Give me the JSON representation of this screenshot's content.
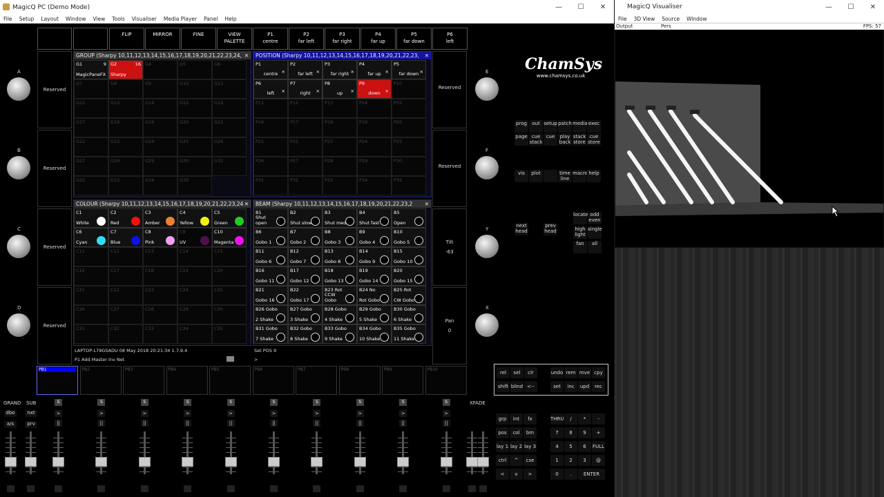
{
  "main_window": {
    "title": "MagicQ PC (Demo Mode)",
    "menu": [
      "File",
      "Setup",
      "Layout",
      "Window",
      "View",
      "Tools",
      "Visualiser",
      "Media Player",
      "Panel",
      "Help"
    ],
    "controls": [
      "—",
      "☐",
      "✕"
    ]
  },
  "top_buttons": [
    "FLIP",
    "MIRROR",
    "FINE",
    "VIEW\nPALETTE",
    "P1\ncentre",
    "P2\nfar left",
    "P3\nfar right",
    "P4\nfar up",
    "P5\nfar down",
    "P6\nleft"
  ],
  "group": {
    "header": "GROUP (Sharpy 10,11,12,13,14,15,16,17,18,19,20,21,22,23,24,",
    "cells": [
      {
        "id": "G1",
        "num": "9",
        "name": "MagicPaneFX",
        "state": "on"
      },
      {
        "id": "G2",
        "num": "16",
        "name": "Sharpy",
        "state": "red"
      },
      {
        "id": "G4"
      },
      {
        "id": "G5"
      },
      {
        "id": "G6"
      },
      {
        "id": "G7"
      },
      {
        "id": "G8"
      },
      {
        "id": "G9"
      },
      {
        "id": "G10"
      },
      {
        "id": "G11"
      },
      {
        "id": "G12"
      },
      {
        "id": "G13"
      },
      {
        "id": "G14"
      },
      {
        "id": "G15"
      },
      {
        "id": "G16"
      },
      {
        "id": "G17"
      },
      {
        "id": "G18"
      },
      {
        "id": "G19"
      },
      {
        "id": "G20"
      },
      {
        "id": "G21"
      },
      {
        "id": "G22"
      },
      {
        "id": "G23"
      },
      {
        "id": "G24"
      },
      {
        "id": "G25"
      },
      {
        "id": "G26"
      },
      {
        "id": "G27"
      },
      {
        "id": "G28"
      },
      {
        "id": "G29"
      },
      {
        "id": "G30"
      },
      {
        "id": "G31"
      },
      {
        "id": "G32"
      },
      {
        "id": "G33"
      },
      {
        "id": "G34"
      },
      {
        "id": "G35"
      }
    ]
  },
  "position": {
    "header": "POSITION (Sharpy 10,11,12,13,14,15,16,17,18,19,20,21,22,23,",
    "cells": [
      {
        "id": "P1",
        "name": "centre",
        "state": "on"
      },
      {
        "id": "P2",
        "name": "far left",
        "state": "on"
      },
      {
        "id": "P3",
        "name": "far right",
        "state": "on"
      },
      {
        "id": "P4",
        "name": "far up",
        "state": "on"
      },
      {
        "id": "P5",
        "name": "far down",
        "state": "on"
      },
      {
        "id": "P6",
        "name": "left",
        "state": "on"
      },
      {
        "id": "P7",
        "name": "right",
        "state": "on"
      },
      {
        "id": "P8",
        "name": "up",
        "state": "on"
      },
      {
        "id": "P9",
        "name": "down",
        "state": "red"
      },
      {
        "id": "P10"
      },
      {
        "id": "P11"
      },
      {
        "id": "P12"
      },
      {
        "id": "P13"
      },
      {
        "id": "P14"
      },
      {
        "id": "P15"
      },
      {
        "id": "P16"
      },
      {
        "id": "P17"
      },
      {
        "id": "P18"
      },
      {
        "id": "P19"
      },
      {
        "id": "P20"
      },
      {
        "id": "P21"
      },
      {
        "id": "P22"
      },
      {
        "id": "P23"
      },
      {
        "id": "P24"
      },
      {
        "id": "P25"
      },
      {
        "id": "P26"
      },
      {
        "id": "P27"
      },
      {
        "id": "P28"
      },
      {
        "id": "P29"
      },
      {
        "id": "P30"
      },
      {
        "id": "P31"
      },
      {
        "id": "P32"
      },
      {
        "id": "P33"
      },
      {
        "id": "P34"
      },
      {
        "id": "P35"
      }
    ]
  },
  "colour": {
    "header": "COLOUR (Sharpy 10,11,12,13,14,15,16,17,18,19,20,21,22,23,24",
    "cells": [
      {
        "id": "C1",
        "name": "White",
        "color": "#ffffff",
        "state": "on"
      },
      {
        "id": "C2",
        "name": "Red",
        "color": "#ee1111",
        "state": "on"
      },
      {
        "id": "C3",
        "name": "Amber",
        "color": "#f08030",
        "state": "on"
      },
      {
        "id": "C4",
        "name": "Yellow",
        "color": "#f0f010",
        "state": "on"
      },
      {
        "id": "C5",
        "name": "Green",
        "color": "#22cc22",
        "state": "on"
      },
      {
        "id": "C6",
        "name": "Cyan",
        "color": "#30e0f0",
        "state": "on"
      },
      {
        "id": "C7",
        "name": "Blue",
        "color": "#1010ee",
        "state": "on"
      },
      {
        "id": "C8",
        "name": "Pink",
        "color": "#f0a0f0",
        "state": "on"
      },
      {
        "id": "C9",
        "name": "UV",
        "color": "#501050",
        "state": "dim"
      },
      {
        "id": "C10",
        "name": "Magenta",
        "color": "#f010f0",
        "state": "on"
      },
      {
        "id": "C11"
      },
      {
        "id": "C12"
      },
      {
        "id": "C13"
      },
      {
        "id": "C14"
      },
      {
        "id": "C15"
      },
      {
        "id": "C16"
      },
      {
        "id": "C17"
      },
      {
        "id": "C18"
      },
      {
        "id": "C19"
      },
      {
        "id": "C20"
      },
      {
        "id": "C21"
      },
      {
        "id": "C22"
      },
      {
        "id": "C23"
      },
      {
        "id": "C24"
      },
      {
        "id": "C25"
      },
      {
        "id": "C26"
      },
      {
        "id": "C27"
      },
      {
        "id": "C28"
      },
      {
        "id": "C29"
      },
      {
        "id": "C30"
      },
      {
        "id": "C31"
      },
      {
        "id": "C32"
      },
      {
        "id": "C33"
      },
      {
        "id": "C34"
      },
      {
        "id": "C35"
      }
    ]
  },
  "beam": {
    "header": "BEAM (Sharpy 10,11,12,13,14,15,16,17,18,19,20,21,22,23,2",
    "cells": [
      {
        "id": "B1",
        "name": "Shut\nopen"
      },
      {
        "id": "B2",
        "name": "Shut slow"
      },
      {
        "id": "B3",
        "name": "Shut med"
      },
      {
        "id": "B4",
        "name": "Shut fast"
      },
      {
        "id": "B5",
        "name": "Open"
      },
      {
        "id": "B6",
        "name": "Gobo 1"
      },
      {
        "id": "B7",
        "name": "Gobo 2"
      },
      {
        "id": "B8",
        "name": "Gobo 3"
      },
      {
        "id": "B9",
        "name": "Gobo 4"
      },
      {
        "id": "B10",
        "name": "Gobo 5"
      },
      {
        "id": "B11",
        "name": "Gobo 6"
      },
      {
        "id": "B12",
        "name": "Gobo 7"
      },
      {
        "id": "B13",
        "name": "Gobo 8"
      },
      {
        "id": "B14",
        "name": "Gobo 9"
      },
      {
        "id": "B15",
        "name": "Gobo 10"
      },
      {
        "id": "B16",
        "name": "Gobo 11"
      },
      {
        "id": "B17",
        "name": "Gobo 12"
      },
      {
        "id": "B18",
        "name": "Gobo 13"
      },
      {
        "id": "B19",
        "name": "Gobo 14"
      },
      {
        "id": "B20",
        "name": "Gobo 15"
      },
      {
        "id": "B21",
        "name": "Gobo 16"
      },
      {
        "id": "B22",
        "name": "Gobo 17"
      },
      {
        "id": "B23 Rot",
        "name": "CCW\nGobo"
      },
      {
        "id": "B24 No",
        "name": "Rot Gobo"
      },
      {
        "id": "B25 Rot",
        "name": "CW Gobo"
      },
      {
        "id": "B26 Gobo",
        "name": "2 Shake"
      },
      {
        "id": "B27 Gobo",
        "name": "3 Shake"
      },
      {
        "id": "B28 Gobo",
        "name": "4 Shake"
      },
      {
        "id": "B29 Gobo",
        "name": "5 Shake"
      },
      {
        "id": "B30 Gobo",
        "name": "6 Shake"
      },
      {
        "id": "B31 Gobo",
        "name": "7 Shake"
      },
      {
        "id": "B32 Gobo",
        "name": "8 Shake"
      },
      {
        "id": "B33 Gobo",
        "name": "9 Shake"
      },
      {
        "id": "B34 Gobo",
        "name": "10 Shake"
      },
      {
        "id": "B35 Gobo",
        "name": "11 Shake"
      }
    ]
  },
  "reserved_left": [
    "Reserved",
    "Reserved",
    "Reserved",
    "Reserved"
  ],
  "right_column": [
    {
      "label": "Reserved",
      "value": ""
    },
    {
      "label": "Reserved",
      "value": ""
    },
    {
      "label": "Tilt",
      "value": "-63"
    },
    {
      "label": "Pan",
      "value": "0"
    }
  ],
  "encoders_left": [
    "A",
    "B",
    "C",
    "D"
  ],
  "encoders_right": [
    "E",
    "F",
    "Y",
    "X"
  ],
  "status_left": "LAPTOP-L79GSADU 08 May 2018 20:21:34 1.7.9.4",
  "status_left2": "P1  Add Master Inv Net",
  "status_right": "Set POS 9",
  "status_right2": ">",
  "logo": {
    "name": "ChamSys",
    "url": "www.chamsys.co.uk"
  },
  "window_buttons": [
    [
      "prog",
      "out",
      "setup",
      "patch",
      "media",
      "exec"
    ],
    [
      "page",
      "cue\nstack",
      "cue",
      "play\nback",
      "stack\nstore",
      "cue\nstore"
    ],
    [
      "vis",
      "plot",
      "",
      "time\nline",
      "macro",
      "help"
    ]
  ],
  "head_buttons": [
    "next\nhead",
    "prev\nhead",
    "locate",
    "odd\neven",
    "high\nlight",
    "single",
    "fan",
    "all"
  ],
  "playbacks": [
    "PB1",
    "PB2",
    "PB3",
    "PB4",
    "PB5",
    "PB6",
    "PB7",
    "PB8",
    "PB9",
    "PB10"
  ],
  "fader_labels": {
    "grand": "GRAND",
    "sub": "SUB",
    "xfade": "XFADE",
    "dbo": "dbo",
    "nxt": "nxt",
    "as": "a/s",
    "prv": "prv"
  },
  "fader_s": "S",
  "keypad_top": [
    [
      "rel",
      "sel",
      "clr",
      "undo",
      "rem",
      "mve",
      "cpy"
    ],
    [
      "shift",
      "blind",
      "<--",
      "set",
      "inc",
      "upd",
      "rec"
    ]
  ],
  "keypad_left": [
    [
      "grp",
      "int",
      "fx"
    ],
    [
      "pos",
      "col",
      "bm"
    ],
    [
      "lay 1",
      "lay 2",
      "lay 3"
    ],
    [
      "ctrl",
      "^",
      "cse"
    ],
    [
      "<",
      "v",
      ">"
    ]
  ],
  "keypad_num": [
    [
      "THRU",
      "/",
      "*",
      "-"
    ],
    [
      "7",
      "8",
      "9",
      "+"
    ],
    [
      "4",
      "5",
      "6",
      "FULL"
    ],
    [
      "1",
      "2",
      "3",
      "@"
    ],
    [
      "0",
      ".",
      "ENTER"
    ]
  ],
  "visualiser": {
    "title": "MagicQ Visualiser",
    "menu": [
      "File",
      "3D View",
      "Source",
      "Window"
    ],
    "output": "Output",
    "view": "Pers",
    "fps": "FPS: 57"
  }
}
